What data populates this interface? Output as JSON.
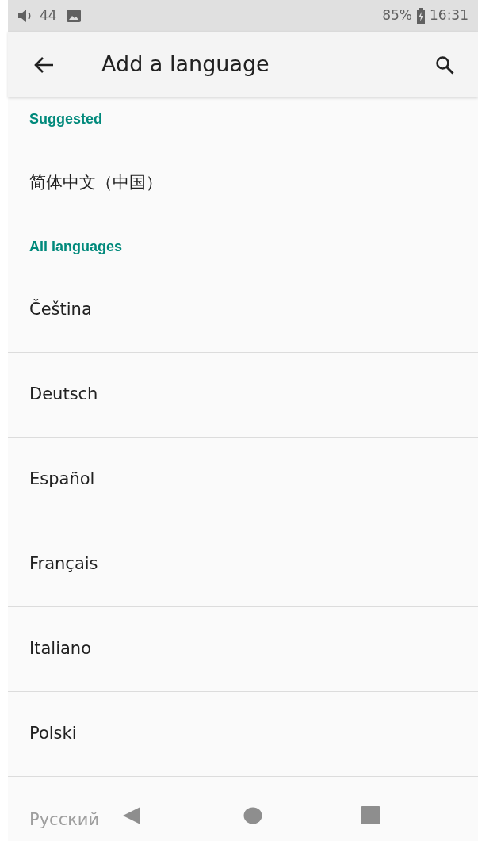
{
  "status_bar": {
    "volume": "44",
    "battery": "85%",
    "time": "16:31"
  },
  "toolbar": {
    "title": "Add a language"
  },
  "sections": [
    {
      "header": "Suggested",
      "items": [
        {
          "label": "简体中文（中国）"
        }
      ]
    },
    {
      "header": "All languages",
      "items": [
        {
          "label": "Čeština"
        },
        {
          "label": "Deutsch"
        },
        {
          "label": "Español"
        },
        {
          "label": "Français"
        },
        {
          "label": "Italiano"
        },
        {
          "label": "Polski"
        },
        {
          "label": "Русский"
        }
      ]
    }
  ]
}
